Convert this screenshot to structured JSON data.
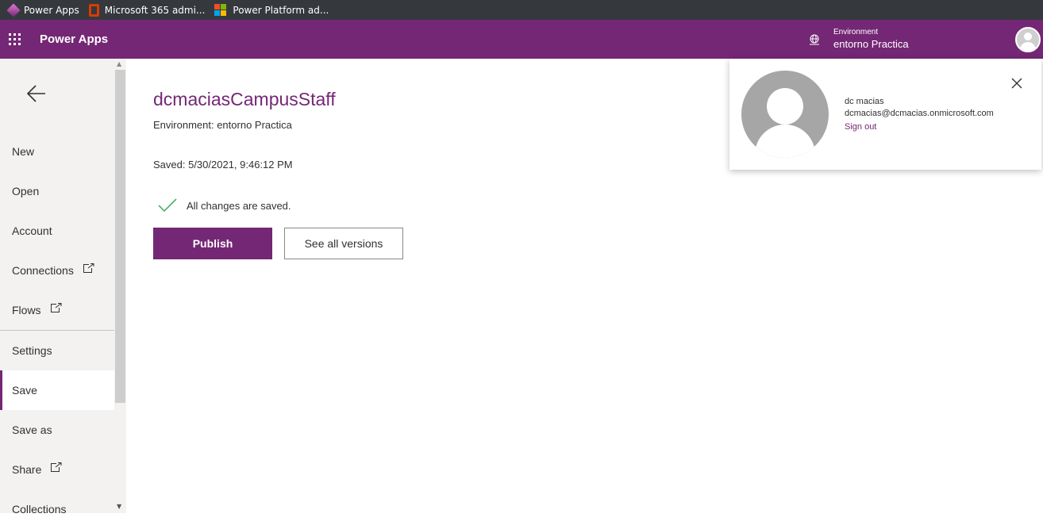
{
  "bookmarks": [
    {
      "label": "Power Apps",
      "icon": "power-apps-icon"
    },
    {
      "label": "Microsoft 365 admi...",
      "icon": "office-icon"
    },
    {
      "label": "Power Platform ad...",
      "icon": "microsoft-logo-icon"
    }
  ],
  "header": {
    "app_title": "Power Apps",
    "environment_label": "Environment",
    "environment_name": "entorno Practica",
    "brand_color": "#742774"
  },
  "sidebar": {
    "items": [
      {
        "label": "New"
      },
      {
        "label": "Open"
      },
      {
        "label": "Account"
      },
      {
        "label": "Connections",
        "external": true
      },
      {
        "label": "Flows",
        "external": true
      },
      {
        "label": "Settings"
      },
      {
        "label": "Save",
        "selected": true
      },
      {
        "label": "Save as"
      },
      {
        "label": "Share",
        "external": true
      },
      {
        "label": "Collections"
      }
    ]
  },
  "main": {
    "title": "dcmaciasCampusStaff",
    "environment": "Environment: entorno Practica",
    "saved": "Saved: 5/30/2021, 9:46:12 PM",
    "status": "All changes are saved.",
    "publish_label": "Publish",
    "versions_label": "See all versions"
  },
  "account_flyout": {
    "name": "dc macias",
    "email": "dcmacias@dcmacias.onmicrosoft.com",
    "sign_out": "Sign out"
  }
}
